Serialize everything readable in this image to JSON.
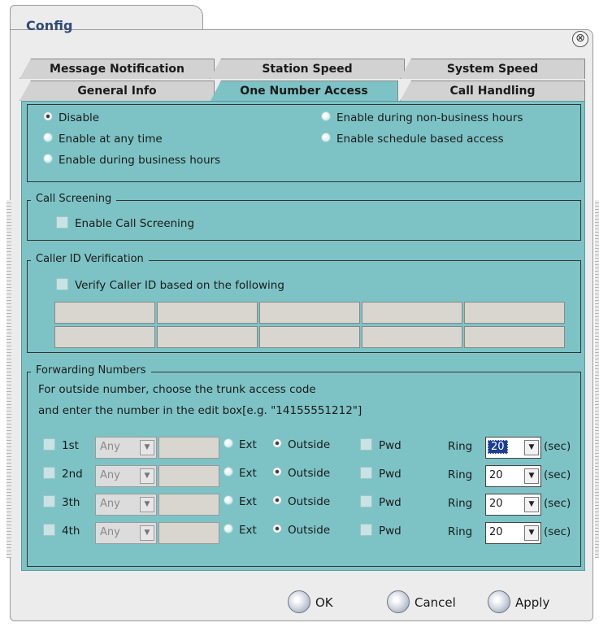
{
  "window": {
    "title": "Config",
    "close_glyph": "⊗"
  },
  "tabs": {
    "row1": [
      "Message Notification",
      "Station Speed",
      "System Speed"
    ],
    "row2": [
      "General Info",
      "One Number Access",
      "Call Handling"
    ],
    "active": "One Number Access"
  },
  "access_mode": {
    "options": [
      "Disable",
      "Enable at any time",
      "Enable during business hours",
      "Enable during non-business hours",
      "Enable schedule based access"
    ],
    "selected": "Disable"
  },
  "call_screening": {
    "legend": "Call Screening",
    "checkbox_label": "Enable Call Screening",
    "checked": false
  },
  "caller_id": {
    "legend": "Caller ID Verification",
    "checkbox_label": "Verify Caller ID based on the following",
    "checked": false
  },
  "forwarding": {
    "legend": "Forwarding Numbers",
    "help_line1": "For outside number, choose the trunk access code",
    "help_line2": "and enter the number in the edit box[e.g. \"14155551212\"]",
    "ext_label": "Ext",
    "outside_label": "Outside",
    "pwd_label": "Pwd",
    "ring_label": "Ring",
    "sec_label": "(sec)",
    "rows": [
      {
        "label": "1st",
        "trunk": "Any",
        "number": "",
        "mode": "Outside",
        "pwd": false,
        "ring": "20",
        "ring_focused": true
      },
      {
        "label": "2nd",
        "trunk": "Any",
        "number": "",
        "mode": "Outside",
        "pwd": false,
        "ring": "20",
        "ring_focused": false
      },
      {
        "label": "3th",
        "trunk": "Any",
        "number": "",
        "mode": "Outside",
        "pwd": false,
        "ring": "20",
        "ring_focused": false
      },
      {
        "label": "4th",
        "trunk": "Any",
        "number": "",
        "mode": "Outside",
        "pwd": false,
        "ring": "20",
        "ring_focused": false
      }
    ]
  },
  "buttons": {
    "ok": "OK",
    "cancel": "Cancel",
    "apply": "Apply"
  },
  "colors": {
    "panel": "#7dc3c6",
    "title": "#2f4a7a",
    "chrome": "#ececec",
    "focus": "#1c3f95"
  }
}
